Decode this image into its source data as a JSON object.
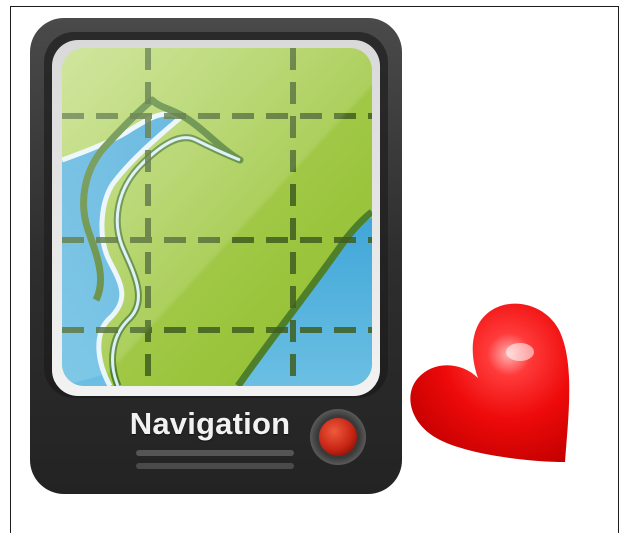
{
  "device": {
    "label": "Navigation",
    "body_color": "#333333",
    "screen_frame_color": "#e6e6e6",
    "button_color": "#cc2a1a",
    "icon": "gps-navigation-device-icon"
  },
  "map": {
    "land_color": "#9dc83a",
    "water_color": "#56b3dc",
    "road_color": "#4e7f2a",
    "grid_color": "#3f5e20"
  },
  "heart": {
    "icon": "heart-icon",
    "color": "#e31010"
  }
}
